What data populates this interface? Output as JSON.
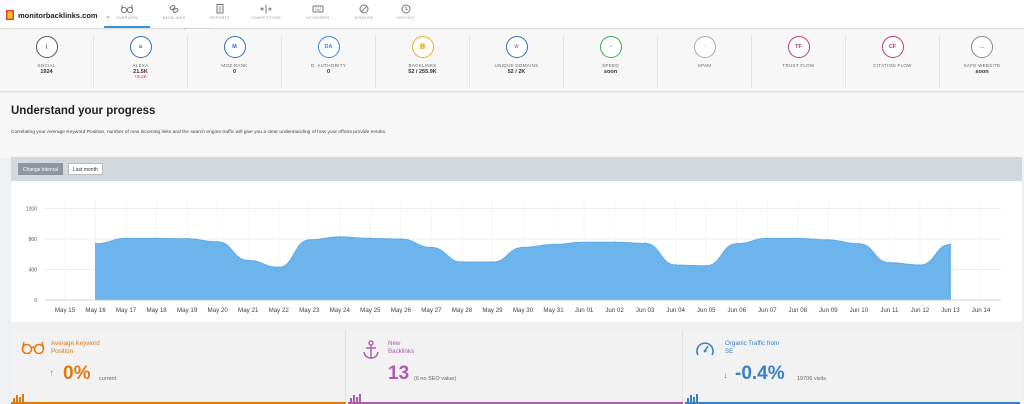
{
  "header": {
    "site": "monitorbacklinks.com"
  },
  "nav": [
    {
      "label": "OVERVIEW",
      "icon": "glasses-icon"
    },
    {
      "label": "BACKLINKS",
      "icon": "link-icon"
    },
    {
      "label": "REPORTS",
      "icon": "report-icon"
    },
    {
      "label": "COMPETITORS",
      "icon": "competitors-icon"
    },
    {
      "label": "KEYWORDS",
      "icon": "keywords-icon"
    },
    {
      "label": "DISAVOW",
      "icon": "disavow-icon"
    },
    {
      "label": "HISTORY",
      "icon": "history-icon"
    }
  ],
  "tooltip": "Backlinks",
  "metrics": [
    {
      "name": "SOCIAL",
      "value": "1924",
      "delta": "",
      "icon_text": "⟨",
      "color": "#555555"
    },
    {
      "name": "ALEXA",
      "value": "21.5K",
      "delta": "+5.2K",
      "icon_text": "a",
      "color": "#2d6fc3"
    },
    {
      "name": "MOZ RANK",
      "value": "0",
      "delta": "",
      "icon_text": "M",
      "color": "#2d6fc3"
    },
    {
      "name": "D. AUTHORITY",
      "value": "0",
      "delta": "",
      "icon_text": "DA",
      "color": "#3b86d8"
    },
    {
      "name": "BACKLINKS",
      "value": "52 / 255.9K",
      "delta": "",
      "icon_text": "⛓",
      "color": "#e8b21a"
    },
    {
      "name": "UNIQUE DOMAINS",
      "value": "52 / 2K",
      "delta": "",
      "icon_text": "☆",
      "color": "#2d6fc3"
    },
    {
      "name": "SPEED",
      "value": "soon",
      "delta": "",
      "icon_text": "◔",
      "color": "#3ea84a"
    },
    {
      "name": "SPAM",
      "value": "",
      "delta": "",
      "icon_text": "·",
      "color": "#aaaaaa"
    },
    {
      "name": "TRUST FLOW",
      "value": "",
      "delta": "",
      "icon_text": "TF",
      "color": "#c0396b"
    },
    {
      "name": "CITATION FLOW",
      "value": "",
      "delta": "",
      "icon_text": "CF",
      "color": "#c0396b"
    },
    {
      "name": "SAFE WEBSITE",
      "value": "soon",
      "delta": "",
      "icon_text": "…",
      "color": "#888888"
    }
  ],
  "progress": {
    "title": "Understand your progress",
    "description": "Correlating your Average Keyword Position, number of new incoming links and the search engine traffic will give you a clear understanding of how your efforts provide results."
  },
  "chart_controls": {
    "change_interval": "Change interval",
    "last_month": "Last month"
  },
  "chart_data": {
    "type": "area",
    "x": [
      "May 15",
      "May 16",
      "May 17",
      "May 18",
      "May 19",
      "May 20",
      "May 21",
      "May 22",
      "May 23",
      "May 24",
      "May 25",
      "May 26",
      "May 27",
      "May 28",
      "May 29",
      "May 30",
      "May 31",
      "Jun 01",
      "Jun 02",
      "Jun 03",
      "Jun 04",
      "Jun 05",
      "Jun 06",
      "Jun 07",
      "Jun 08",
      "Jun 09",
      "Jun 10",
      "Jun 11",
      "Jun 12",
      "Jun 13",
      "Jun 14"
    ],
    "values": [
      null,
      740,
      810,
      810,
      805,
      765,
      520,
      430,
      790,
      830,
      810,
      800,
      690,
      500,
      500,
      690,
      730,
      760,
      760,
      745,
      460,
      450,
      740,
      810,
      810,
      790,
      740,
      490,
      460,
      730,
      null
    ],
    "y_ticks": [
      0,
      400,
      800,
      1200
    ],
    "ylim": [
      0,
      1300
    ],
    "grid": true,
    "color": "#6cb4ec"
  },
  "cards": [
    {
      "title": "Average Keyword Position",
      "value": "0%",
      "arrow": "↑",
      "sub": "current",
      "color": "#e07a10"
    },
    {
      "title": "New Backlinks",
      "value": "13",
      "arrow": "",
      "sub": "(6 no SEO value)",
      "color": "#b05cae"
    },
    {
      "title": "Organic Traffic from SE",
      "value": "-0.4%",
      "arrow": "↓",
      "sub": "19706 visits",
      "color": "#3a80c8"
    }
  ]
}
